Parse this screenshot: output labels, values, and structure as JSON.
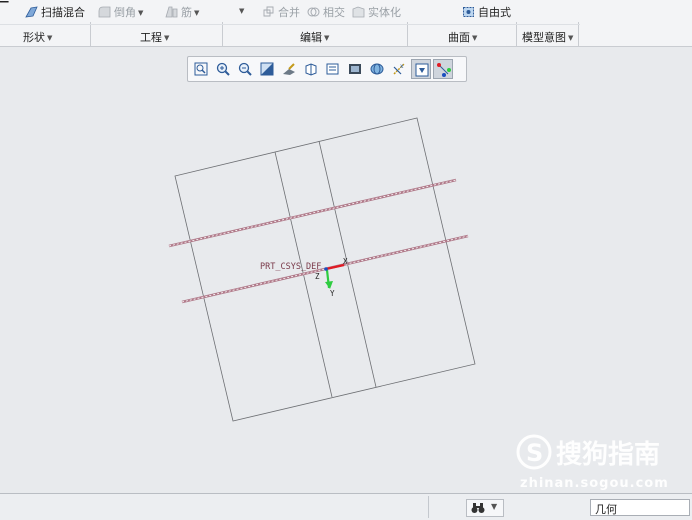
{
  "ribbon": {
    "row1": {
      "sweep_blend": "扫描混合",
      "round": "倒角",
      "rib": "筋",
      "merge": "合并",
      "intersect": "相交",
      "solidify": "实体化",
      "freestyle": "自由式"
    },
    "groups": {
      "shape": "形状",
      "engineering": "工程",
      "edit": "编辑",
      "surface": "曲面",
      "model_intent": "模型意图"
    }
  },
  "graphics": {
    "csys_label": "PRT_CSYS_DEF",
    "axis_x": "X",
    "axis_y": "Y",
    "axis_z": "Z"
  },
  "status": {
    "selection_filter": "几何"
  },
  "watermark": {
    "brand": "搜狗指南",
    "url": "zhinan.sogou.com"
  },
  "colors": {
    "background": "#e8eaed",
    "x_axis": "#e01b24",
    "y_axis": "#2ecc40",
    "datum_line": "#b07a8a"
  }
}
